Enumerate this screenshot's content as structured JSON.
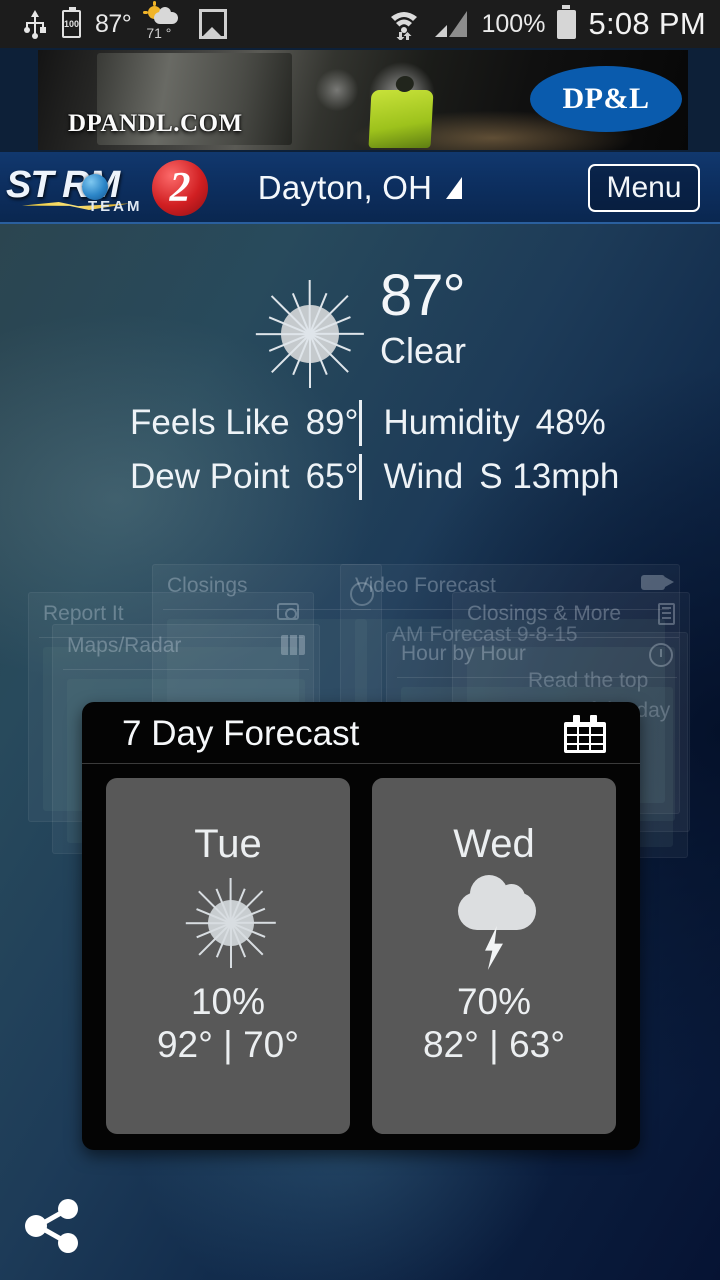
{
  "status_bar": {
    "usb_icon": "usb-icon",
    "battery_widget_icon": "battery-widget-icon",
    "battery_widget_value": "100",
    "widget_temp": "87°",
    "weather_widget_icon": "sun-behind-cloud-icon",
    "weather_widget_temp": "71 °",
    "gallery_icon": "gallery-icon",
    "wifi_icon": "wifi-icon",
    "signal_icon": "cellular-signal-icon",
    "battery_percent": "100%",
    "battery_icon": "battery-icon",
    "clock": "5:08 PM"
  },
  "ad": {
    "url_text": "DPANDL.COM",
    "logo_text": "DP&L",
    "logo_color": "#0a5bad"
  },
  "header": {
    "logo_storm": "ST    RM",
    "logo_number": "2",
    "logo_team": "TEAM",
    "city": "Dayton, OH",
    "city_caret_icon": "dropdown-caret-icon",
    "menu_label": "Menu",
    "bar_color": "#0d2f60"
  },
  "current": {
    "condition_icon": "sun-icon",
    "temperature": "87°",
    "condition": "Clear",
    "metrics": [
      {
        "label": "Feels Like",
        "value": "89°"
      },
      {
        "label": "Humidity",
        "value": "48%"
      },
      {
        "label": "Dew Point",
        "value": "65°"
      },
      {
        "label": "Wind",
        "value": "S 13mph"
      }
    ]
  },
  "background_tiles": [
    {
      "title": "Report It",
      "icon": "camera-icon"
    },
    {
      "title": "Closings",
      "icon": ""
    },
    {
      "title": "Maps/Radar",
      "icon": "map-icon"
    },
    {
      "title": "Video Forecast",
      "icon": "video-camera-icon"
    },
    {
      "title": "Closings & More",
      "icon": "list-icon"
    },
    {
      "title": "AM Forecast 9-8-15",
      "icon": "globe-icon"
    },
    {
      "title": "Hour by Hour",
      "icon": "clock-icon"
    },
    {
      "title": "Read the top",
      "icon": ""
    },
    {
      "title": "posts of the day",
      "icon": ""
    }
  ],
  "forecast_panel": {
    "title": "7 Day Forecast",
    "calendar_icon": "calendar-icon",
    "days": [
      {
        "day": "Tue",
        "icon": "sun-icon",
        "precip": "10%",
        "high_low": "92° | 70°",
        "high": "92°",
        "low": "70°"
      },
      {
        "day": "Wed",
        "icon": "thunderstorm-icon",
        "precip": "70%",
        "high_low": "82° | 63°",
        "high": "82°",
        "low": "63°"
      }
    ]
  },
  "share": {
    "icon": "share-icon"
  }
}
